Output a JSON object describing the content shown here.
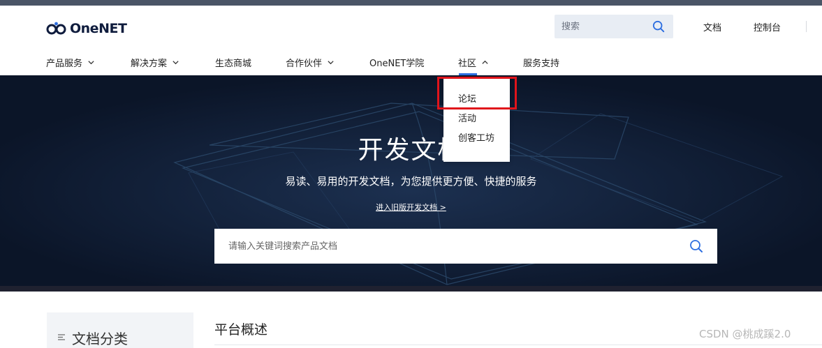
{
  "brand": {
    "logo_text": "OneNET"
  },
  "header": {
    "search_placeholder": "搜索",
    "links": [
      "文档",
      "控制台"
    ]
  },
  "nav": {
    "items": [
      {
        "label": "产品服务"
      },
      {
        "label": "解决方案"
      },
      {
        "label": "生态商城"
      },
      {
        "label": "合作伙伴"
      },
      {
        "label": "OneNET学院"
      },
      {
        "label": "社区"
      },
      {
        "label": "服务支持"
      }
    ],
    "active": "社区"
  },
  "community_dropdown": {
    "items": [
      "论坛",
      "活动",
      "创客工坊"
    ],
    "highlighted": "论坛"
  },
  "hero": {
    "title": "开发文档",
    "subtitle": "易读、易用的开发文档，为您提供更方便、快捷的服务",
    "old_docs_link": "进入旧版开发文档 >",
    "search_placeholder": "请输入关键词搜索产品文档"
  },
  "sidebar": {
    "title": "文档分类"
  },
  "content": {
    "title": "平台概述"
  },
  "watermark": "CSDN @桃成蹊2.0",
  "colors": {
    "accent": "#2d6ee0",
    "hero_bg": "#0f1b33",
    "highlight": "#e0141b",
    "top_strip": "#4a5566"
  }
}
